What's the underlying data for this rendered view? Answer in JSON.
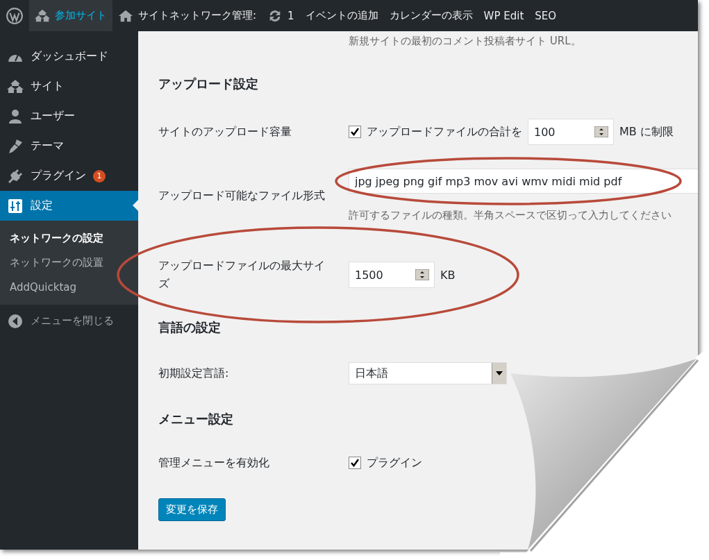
{
  "admin_bar": [
    {
      "kind": "logo"
    },
    {
      "kind": "sites",
      "label": "参加サイト",
      "selected": true
    },
    {
      "kind": "home",
      "label": "サイトネットワーク管理:",
      "selected": false
    },
    {
      "kind": "updates",
      "label": "1",
      "selected": false
    },
    {
      "kind": "text",
      "label": "イベントの追加",
      "selected": false
    },
    {
      "kind": "text",
      "label": "カレンダーの表示",
      "selected": false
    },
    {
      "kind": "text",
      "label": "WP Edit",
      "selected": false
    },
    {
      "kind": "text",
      "label": "SEO",
      "selected": false
    }
  ],
  "sidebar": {
    "items": [
      {
        "kind": "dashboard",
        "label": "ダッシュボード",
        "selected": false
      },
      {
        "kind": "sites",
        "label": "サイト",
        "selected": false
      },
      {
        "kind": "user",
        "label": "ユーザー",
        "selected": false
      },
      {
        "kind": "brush",
        "label": "テーマ",
        "selected": false
      },
      {
        "kind": "plug",
        "label": "プラグイン",
        "badge": "1",
        "selected": false
      },
      {
        "kind": "sliders",
        "label": "設定",
        "selected": true
      }
    ],
    "submenu": [
      {
        "label": "ネットワークの設定",
        "selected": true
      },
      {
        "label": "ネットワークの設置",
        "selected": false
      },
      {
        "label": "AddQuicktag",
        "selected": false
      }
    ],
    "collapse": "メニューを閉じる"
  },
  "content": {
    "top_description": "新規サイトの最初のコメント投稿者サイト URL。",
    "sections": [
      {
        "heading": "アップロード設定",
        "rows": [
          {
            "kind": "checkbox_number",
            "label": "サイトのアップロード容量",
            "checked": true,
            "text": "アップロードファイルの合計を",
            "value": "100",
            "unit": "MB に制限"
          },
          {
            "kind": "text",
            "label": "アップロード可能なファイル形式",
            "value": "jpg jpeg png gif mp3 mov avi wmv midi mid pdf",
            "description": "許可するファイルの種類。半角スペースで区切って入力してください",
            "circled": true
          },
          {
            "kind": "number",
            "label": "アップロードファイルの最大サイズ",
            "value": "1500",
            "unit": "KB",
            "circled": true
          }
        ]
      },
      {
        "heading": "言語の設定",
        "rows": [
          {
            "kind": "select",
            "label": "初期設定言語:",
            "value": "日本語"
          }
        ]
      },
      {
        "heading": "メニュー設定",
        "rows": [
          {
            "kind": "checkbox",
            "label": "管理メニューを有効化",
            "checked": true,
            "text": "プラグイン"
          }
        ]
      }
    ],
    "save_button": "変更を保存"
  }
}
